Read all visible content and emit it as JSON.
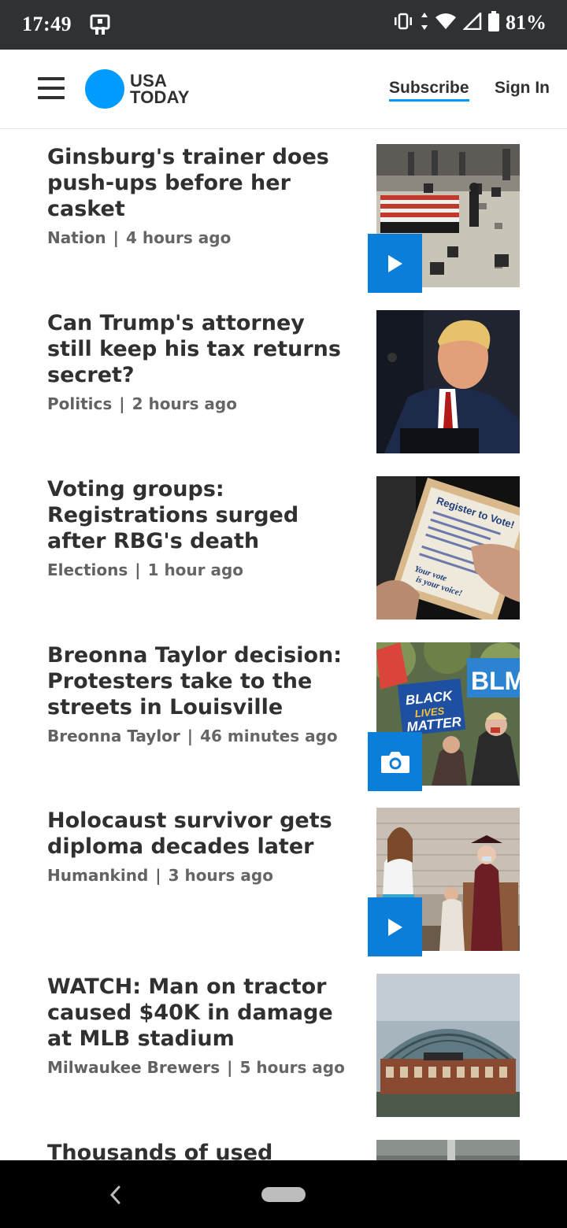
{
  "status_bar": {
    "time": "17:49",
    "battery": "81%",
    "icons": [
      "sim-card-icon",
      "vibrate-icon",
      "data-arrows-icon",
      "wifi-icon",
      "signal-icon",
      "battery-icon"
    ]
  },
  "header": {
    "logo_line1": "USA",
    "logo_line2": "TODAY",
    "subscribe": "Subscribe",
    "sign_in": "Sign In",
    "menu_icon": "hamburger-menu-icon",
    "brand_color": "#009bff"
  },
  "articles": [
    {
      "headline": "Ginsburg's trainer does push-ups before her casket",
      "section": "Nation",
      "time": "4 hours ago",
      "media": "video"
    },
    {
      "headline": "Can Trump's attorney still keep his tax returns secret?",
      "section": "Politics",
      "time": "2 hours ago",
      "media": "none"
    },
    {
      "headline": "Voting groups: Registrations surged after RBG's death",
      "section": "Elections",
      "time": "1 hour ago",
      "media": "none"
    },
    {
      "headline": "Breonna Taylor decision: Protesters take to the streets in Louisville",
      "section": "Breonna Taylor",
      "time": "46 minutes ago",
      "media": "gallery"
    },
    {
      "headline": "Holocaust survivor gets diploma decades later",
      "section": "Humankind",
      "time": "3 hours ago",
      "media": "video"
    },
    {
      "headline": "WATCH: Man on tractor caused $40K in damage at MLB stadium",
      "section": "Milwaukee Brewers",
      "time": "5 hours ago",
      "media": "none"
    },
    {
      "headline": "Thousands of used",
      "section": "",
      "time": "",
      "media": "none"
    }
  ],
  "thumb_text": {
    "register_1": "Register to Vote!",
    "register_2": "Your vote",
    "register_3": "is your voice!",
    "sign_1": "BLACK",
    "sign_2": "LIVES",
    "sign_3": "MATTER",
    "sign_4": "BLM"
  },
  "colors": {
    "badge": "#0b7ed9",
    "text": "#303030",
    "meta": "#666666"
  },
  "nav": {
    "back_icon": "back-chevron-icon",
    "home_icon": "home-pill-icon"
  }
}
